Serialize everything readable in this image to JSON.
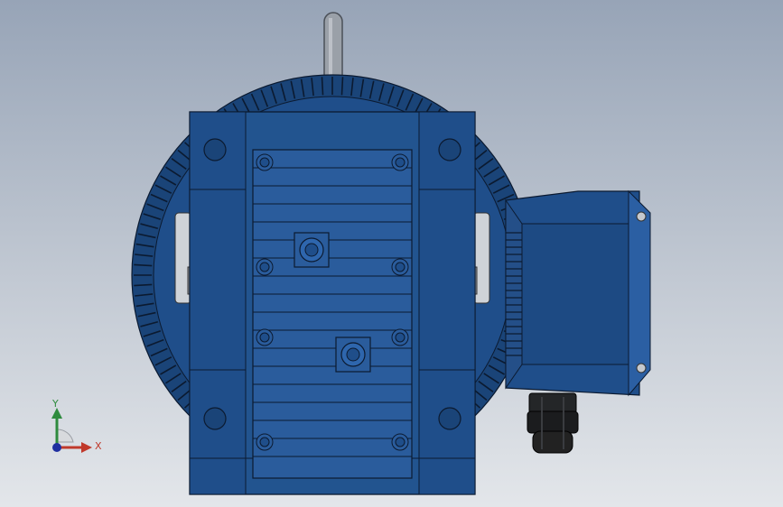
{
  "scene": {
    "model": "motor-front-view",
    "colors": {
      "body": "#1f4e8a",
      "body_dark": "#183d6e",
      "body_light": "#2e66ad",
      "outline": "#0b1a30",
      "steel": "#9aa0a8",
      "gland": "#1b1c1e"
    }
  },
  "triad": {
    "x_label": "X",
    "y_label": "Y",
    "x_color": "#c0392b",
    "y_color": "#2e8b3e",
    "z_color": "#1f2fa0"
  }
}
